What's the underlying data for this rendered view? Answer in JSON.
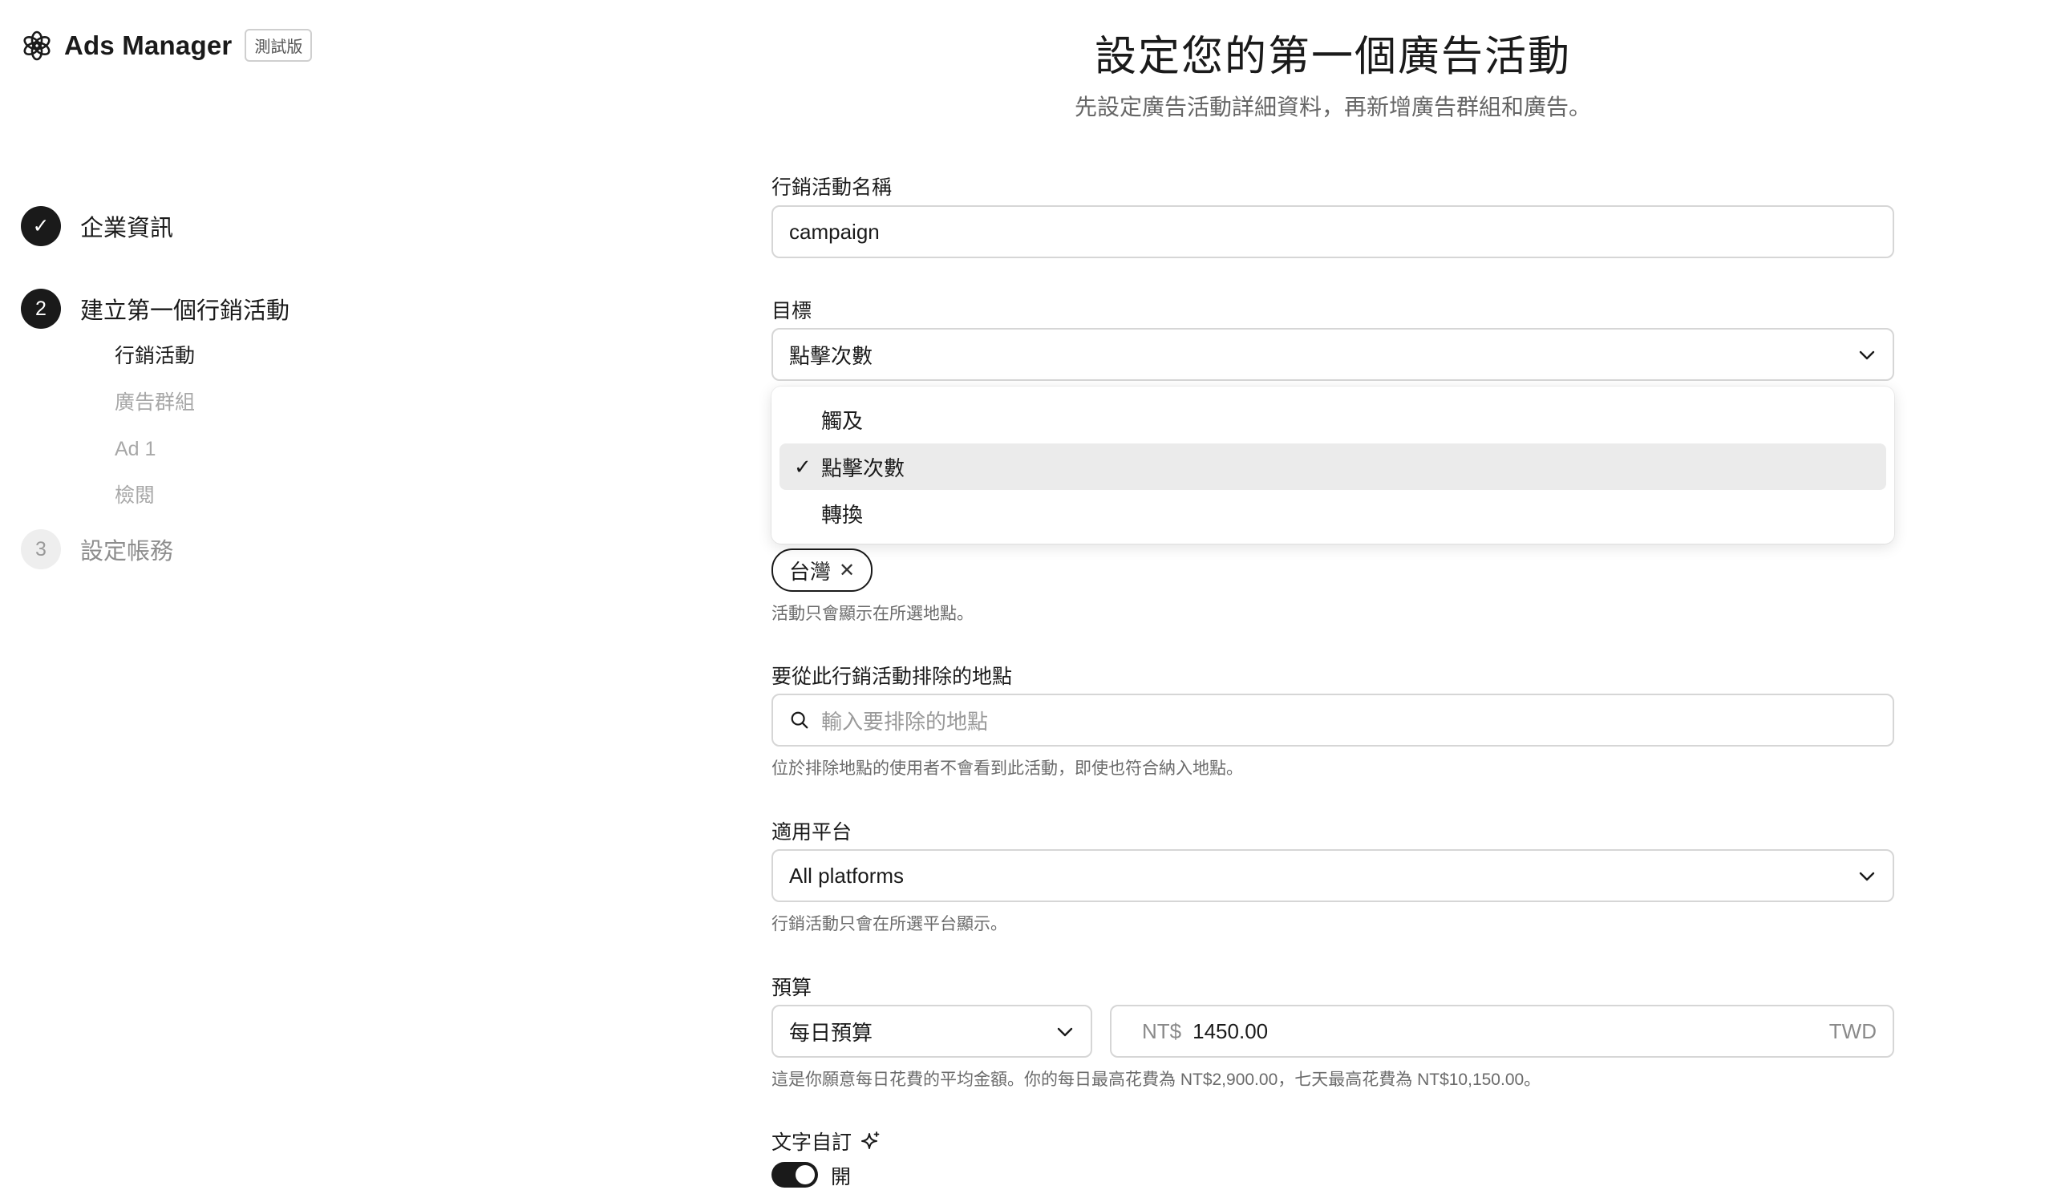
{
  "brand": {
    "name": "Ads Manager",
    "badge": "測試版"
  },
  "steps": [
    {
      "num": "✓",
      "label": "企業資訊",
      "state": "done"
    },
    {
      "num": "2",
      "label": "建立第一個行銷活動",
      "state": "active"
    },
    {
      "num": "3",
      "label": "設定帳務",
      "state": "pending"
    }
  ],
  "substeps": [
    "行銷活動",
    "廣告群組",
    "Ad 1",
    "檢閱"
  ],
  "page": {
    "title": "設定您的第一個廣告活動",
    "subtitle": "先設定廣告活動詳細資料，再新增廣告群組和廣告。"
  },
  "form": {
    "name_label": "行銷活動名稱",
    "name_value": "campaign",
    "objective_label": "目標",
    "objective_value": "點擊次數",
    "objective_options": [
      "觸及",
      "點擊次數",
      "轉換"
    ],
    "location_chip": "台灣",
    "location_hint": "活動只會顯示在所選地點。",
    "exclude_label": "要從此行銷活動排除的地點",
    "exclude_placeholder": "輸入要排除的地點",
    "exclude_hint": "位於排除地點的使用者不會看到此活動，即使也符合納入地點。",
    "platform_label": "適用平台",
    "platform_value": "All platforms",
    "platform_hint": "行銷活動只會在所選平台顯示。",
    "budget_label": "預算",
    "budget_type": "每日預算",
    "budget_currency": "NT$",
    "budget_amount": "1450.00",
    "budget_unit": "TWD",
    "budget_hint": "這是你願意每日花費的平均金額。你的每日最高花費為 NT$2,900.00，七天最高花費為 NT$10,150.00。",
    "text_custom_label": "文字自訂",
    "toggle_label": "開",
    "toggle_on": true
  },
  "colors": {
    "primary": "#1a1a1a",
    "selected_bg": "#ebebeb",
    "border": "#d6d6d6"
  },
  "icons": {
    "logo": "openai-logo-icon",
    "search": "search-icon",
    "chevron": "chevron-down-icon",
    "sparkle": "sparkle-icon",
    "remove": "close-icon"
  }
}
